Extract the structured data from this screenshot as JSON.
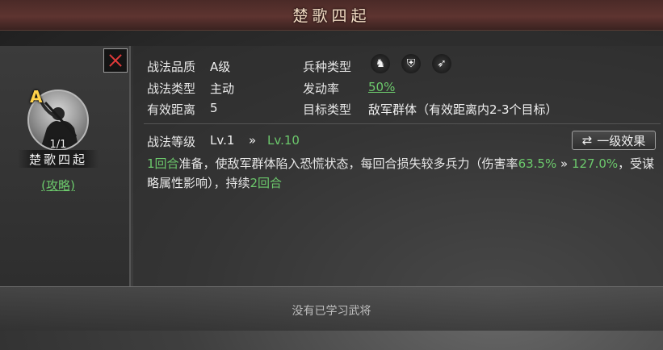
{
  "header": {
    "title": "楚歌四起"
  },
  "tactic": {
    "grade": "A",
    "count": "1/1",
    "name": "楚歌四起",
    "guide_link": "(攻略)"
  },
  "info": {
    "quality_label": "战法品质",
    "quality_value": "A级",
    "type_label": "战法类型",
    "type_value": "主动",
    "range_label": "有效距离",
    "range_value": "5",
    "troop_label": "兵种类型",
    "troop_icons": [
      "cavalry-icon",
      "shield-icon",
      "bow-icon"
    ],
    "rate_label": "发动率",
    "rate_value": "50%",
    "target_label": "目标类型",
    "target_value": "敌军群体（有效距离内2-3个目标）"
  },
  "level": {
    "label": "战法等级",
    "current": "Lv.1",
    "arrow": "»",
    "max": "Lv.10",
    "effect_button": "一级效果"
  },
  "description": {
    "seg1_green": "1回合",
    "seg2": "准备，使敌军群体陷入恐慌状态，每回合损失较多兵力（伤害率",
    "seg3_green": "63.5%",
    "seg4": " » ",
    "seg5_green": "127.0%",
    "seg6": "，受谋略属性影响），持续",
    "seg7_green": "2回合"
  },
  "footer": {
    "status": "没有已学习武将"
  },
  "colors": {
    "highlight_green": "#6cc96c",
    "grade_gold": "#ffd24a",
    "close_red": "#e23a3a"
  }
}
